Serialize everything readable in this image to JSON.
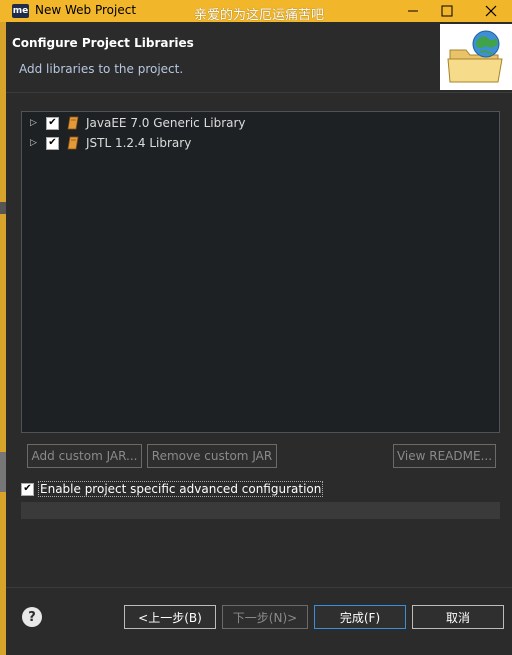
{
  "window": {
    "app_badge": "me",
    "title": "New Web Project",
    "overlay_text": "亲爱的为这厄运痛苦吧"
  },
  "header": {
    "title": "Configure Project Libraries",
    "subtitle": "Add libraries to the project."
  },
  "libraries": [
    {
      "label": "JavaEE 7.0 Generic Library",
      "checked": true
    },
    {
      "label": "JSTL 1.2.4 Library",
      "checked": true
    }
  ],
  "buttons": {
    "add_custom_jar": "Add custom JAR...",
    "remove_custom_jar": "Remove custom JAR",
    "view_readme": "View README..."
  },
  "advanced": {
    "label": "Enable project specific advanced configuration",
    "checked": true
  },
  "footer": {
    "back": "<上一步(B)",
    "next": "下一步(N)>",
    "finish": "完成(F)",
    "cancel": "取消"
  },
  "colors": {
    "titlebar": "#f2b62b",
    "dialog_bg": "#2b2b2b",
    "primary_border": "#3b8ed8"
  }
}
